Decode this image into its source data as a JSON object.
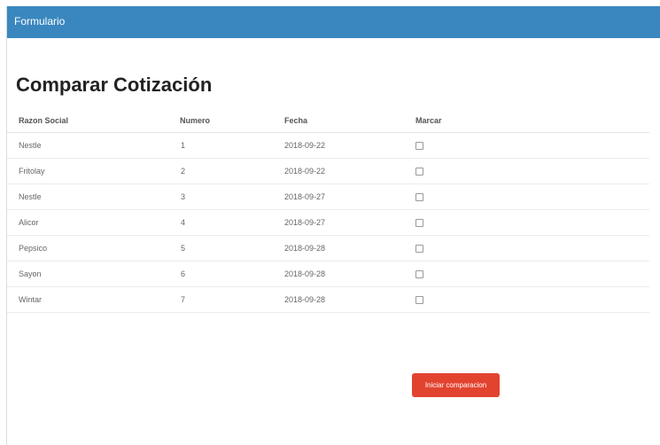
{
  "header": {
    "title": "Formulario"
  },
  "page": {
    "title": "Comparar Cotización"
  },
  "table": {
    "columns": [
      "Razon Social",
      "Numero",
      "Fecha",
      "Marcar"
    ],
    "rows": [
      {
        "razon_social": "Nestle",
        "numero": "1",
        "fecha": "2018-09-22",
        "marcar": false
      },
      {
        "razon_social": "Fritolay",
        "numero": "2",
        "fecha": "2018-09-22",
        "marcar": false
      },
      {
        "razon_social": "Nestle",
        "numero": "3",
        "fecha": "2018-09-27",
        "marcar": false
      },
      {
        "razon_social": "Alicor",
        "numero": "4",
        "fecha": "2018-09-27",
        "marcar": false
      },
      {
        "razon_social": "Pepsico",
        "numero": "5",
        "fecha": "2018-09-28",
        "marcar": false
      },
      {
        "razon_social": "Sayon",
        "numero": "6",
        "fecha": "2018-09-28",
        "marcar": false
      },
      {
        "razon_social": "Wintar",
        "numero": "7",
        "fecha": "2018-09-28",
        "marcar": false
      }
    ]
  },
  "actions": {
    "compare_label": "Iniciar comparacion"
  },
  "colors": {
    "header_bar": "#3a87bf",
    "compare_button": "#e2432f"
  }
}
